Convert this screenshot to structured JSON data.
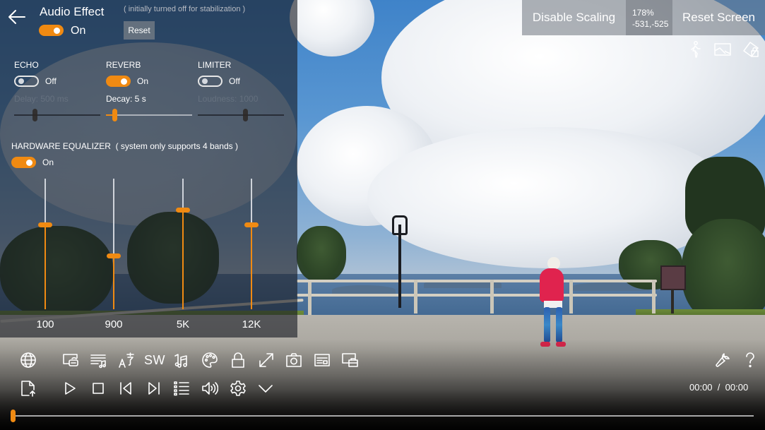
{
  "audio_effect": {
    "title": "Audio Effect",
    "hint": "( initially turned off for stabilization )",
    "reset_label": "Reset",
    "master_toggle": {
      "state": "on",
      "label": "On"
    },
    "echo": {
      "label": "ECHO",
      "toggle_label": "Off",
      "enabled": false,
      "param_label": "Delay: 500 ms",
      "value_fraction": 0.24
    },
    "reverb": {
      "label": "REVERB",
      "toggle_label": "On",
      "enabled": true,
      "param_label": "Decay: 5 s",
      "value_fraction": 0.1
    },
    "limiter": {
      "label": "LIMITER",
      "toggle_label": "Off",
      "enabled": false,
      "param_label": "Loudness: 1000",
      "value_fraction": 0.55
    },
    "equalizer": {
      "label": "HARDWARE EQUALIZER",
      "note": "( system only supports 4 bands )",
      "toggle_label": "On",
      "enabled": true,
      "bands": [
        {
          "label": "100",
          "value_fraction": 0.65
        },
        {
          "label": "900",
          "value_fraction": 0.41
        },
        {
          "label": "5K",
          "value_fraction": 0.76
        },
        {
          "label": "12K",
          "value_fraction": 0.65
        }
      ]
    }
  },
  "scaling": {
    "disable_label": "Disable Scaling",
    "zoom": "178%",
    "offset": "-531,-525",
    "reset_label": "Reset Screen"
  },
  "top_right_icons": [
    "pedestrian-icon",
    "picture-icon",
    "rotate-lock-icon"
  ],
  "toolbar": {
    "row1": [
      "globe-icon",
      "cast-icon",
      "playlist-music-icon",
      "subtitle-language-icon",
      "sw-decoder",
      "music-notes-icon",
      "palette-icon",
      "lock-icon",
      "fullscreen-icon",
      "camera-icon",
      "caption-icon",
      "screen-briefcase-icon"
    ],
    "sw_label": "SW",
    "row2": [
      "open-file-icon",
      "play-icon",
      "stop-icon",
      "previous-icon",
      "next-icon",
      "playlist-icon",
      "volume-icon",
      "settings-icon",
      "collapse-chevron-icon"
    ],
    "right": [
      "wrench-icon",
      "help-icon"
    ]
  },
  "playback": {
    "current_time": "00:00",
    "separator": "/",
    "total_time": "00:00",
    "progress_fraction": 0.0
  },
  "colors": {
    "accent": "#f08a12"
  }
}
